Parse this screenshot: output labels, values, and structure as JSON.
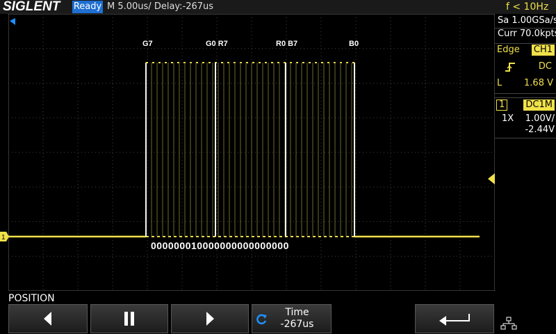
{
  "header": {
    "brand": "SIGLENT",
    "status": "Ready",
    "timebase": "M 5.00us/  Delay:-267us",
    "frequency": "f < 10Hz"
  },
  "right_panel": {
    "sample_rate": "Sa 1.00GSa/s",
    "memory": "Curr 70.0kpts",
    "trigger_type": "Edge",
    "trigger_source": "CH1",
    "coupling": "DC",
    "level_label": "L",
    "level_value": "1.68 V",
    "channel_number": "1",
    "channel_coupling": "DC1M",
    "probe": "1X",
    "volts_per_div": "1.00V/",
    "offset": "-2.44V"
  },
  "markers": [
    "G7",
    "G0 R7",
    "R0 B7",
    "B0"
  ],
  "decoded_bits": "000000010000000000000000",
  "channel_marker": "1",
  "colors": {
    "trace": "#f0e14a",
    "status_bg": "#1e6fd0"
  },
  "softkeys": {
    "section_label": "POSITION",
    "time_label": "Time",
    "time_value": "-267us",
    "icons": [
      "left-arrow-icon",
      "pause-icon",
      "right-arrow-icon",
      "rotate-knob-icon",
      "return-icon",
      "network-icon"
    ]
  }
}
